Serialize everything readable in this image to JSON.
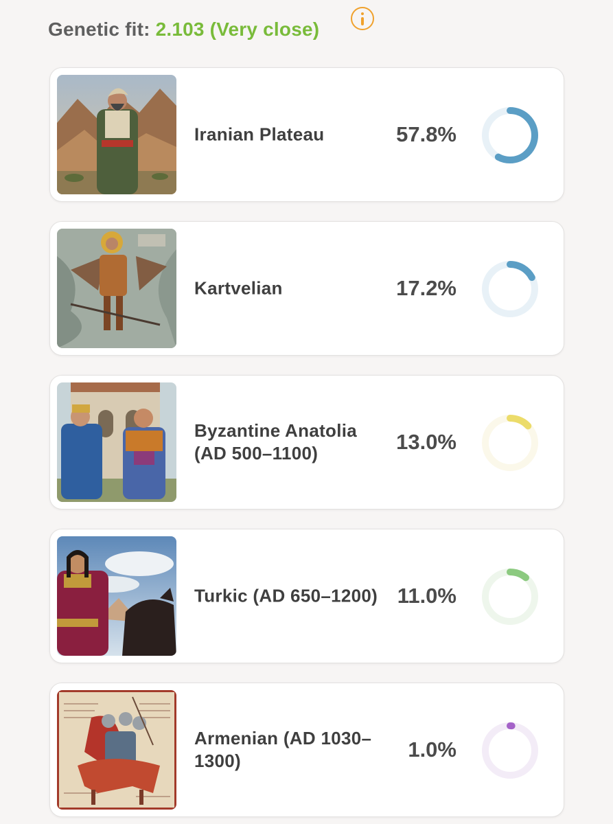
{
  "header": {
    "label": "Genetic fit:",
    "value": "2.103 (Very close)",
    "info_icon": "info-icon",
    "accent_color": "#79bb3a",
    "info_color": "#f0a12c"
  },
  "populations": [
    {
      "name": "Iranian Plateau",
      "percent_text": "57.8%",
      "fraction": 0.578,
      "color": "#5b9ec5",
      "track": "#e8f1f7",
      "image": "man-in-turban-desert-painting"
    },
    {
      "name": "Kartvelian",
      "percent_text": "17.2%",
      "fraction": 0.172,
      "color": "#5b9ec5",
      "track": "#e8f1f7",
      "image": "fresco-warrior-saint"
    },
    {
      "name": "Byzantine Anatolia (AD 500–1100)",
      "percent_text": "13.0%",
      "fraction": 0.13,
      "color": "#ecdc6a",
      "track": "#fbf8ea",
      "image": "byzantine-men-fortress"
    },
    {
      "name": "Turkic (AD 650–1200)",
      "percent_text": "11.0%",
      "fraction": 0.11,
      "color": "#8cca80",
      "track": "#eef6ec",
      "image": "rider-on-horse"
    },
    {
      "name": "Armenian (AD 1030–1300)",
      "percent_text": "1.0%",
      "fraction": 0.01,
      "color": "#a462c8",
      "track": "#f3ecf7",
      "image": "manuscript-horseman"
    }
  ]
}
